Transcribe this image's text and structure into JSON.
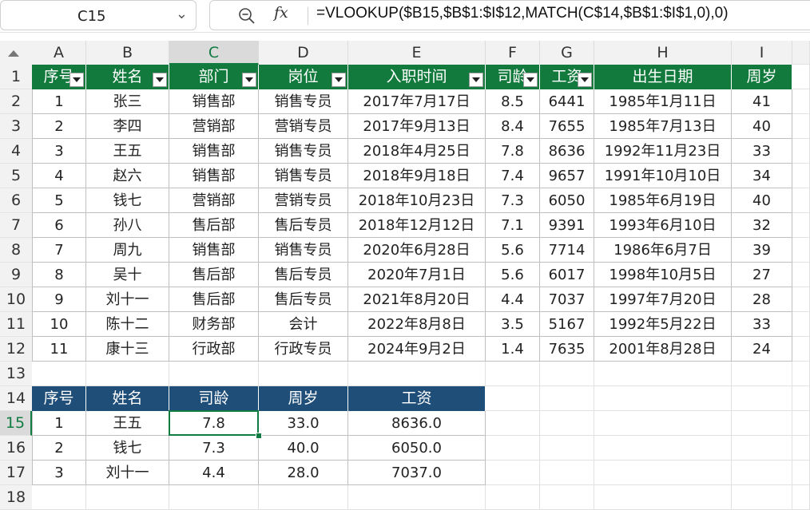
{
  "name_box": {
    "value": "C15"
  },
  "formula_bar": {
    "formula": "=VLOOKUP($B15,$B$1:$I$12,MATCH(C$14,$B$1:$I$1,0),0)"
  },
  "column_headers": [
    "A",
    "B",
    "C",
    "D",
    "E",
    "F",
    "G",
    "H",
    "I"
  ],
  "row_headers": [
    "1",
    "2",
    "3",
    "4",
    "5",
    "6",
    "7",
    "8",
    "9",
    "10",
    "11",
    "12",
    "13",
    "14",
    "15",
    "16",
    "17",
    "18"
  ],
  "selected_cell": "C15",
  "table1": {
    "headers": [
      "序号",
      "姓名",
      "部门",
      "岗位",
      "入职时间",
      "司龄",
      "工资",
      "出生日期",
      "周岁"
    ],
    "rows": [
      [
        "1",
        "张三",
        "销售部",
        "销售专员",
        "2017年7月17日",
        "8.5",
        "6441",
        "1985年1月11日",
        "41"
      ],
      [
        "2",
        "李四",
        "营销部",
        "营销专员",
        "2017年9月13日",
        "8.4",
        "7655",
        "1985年7月13日",
        "40"
      ],
      [
        "3",
        "王五",
        "销售部",
        "销售专员",
        "2018年4月25日",
        "7.8",
        "8636",
        "1992年11月23日",
        "33"
      ],
      [
        "4",
        "赵六",
        "销售部",
        "销售专员",
        "2018年9月18日",
        "7.4",
        "9657",
        "1991年10月10日",
        "34"
      ],
      [
        "5",
        "钱七",
        "营销部",
        "营销专员",
        "2018年10月23日",
        "7.3",
        "6050",
        "1985年6月19日",
        "40"
      ],
      [
        "6",
        "孙八",
        "售后部",
        "售后专员",
        "2018年12月12日",
        "7.1",
        "9391",
        "1993年6月10日",
        "32"
      ],
      [
        "7",
        "周九",
        "销售部",
        "销售专员",
        "2020年6月28日",
        "5.6",
        "7714",
        "1986年6月7日",
        "39"
      ],
      [
        "8",
        "吴十",
        "售后部",
        "售后专员",
        "2020年7月1日",
        "5.6",
        "6017",
        "1998年10月5日",
        "27"
      ],
      [
        "9",
        "刘十一",
        "售后部",
        "售后专员",
        "2021年8月20日",
        "4.4",
        "7037",
        "1997年7月20日",
        "28"
      ],
      [
        "10",
        "陈十二",
        "财务部",
        "会计",
        "2022年8月8日",
        "3.5",
        "5167",
        "1992年5月22日",
        "33"
      ],
      [
        "11",
        "康十三",
        "行政部",
        "行政专员",
        "2024年9月2日",
        "1.4",
        "7635",
        "2001年8月28日",
        "24"
      ]
    ]
  },
  "table2": {
    "headers": [
      "序号",
      "姓名",
      "司龄",
      "周岁",
      "工资"
    ],
    "rows": [
      [
        "1",
        "王五",
        "7.8",
        "33.0",
        "8636.0"
      ],
      [
        "2",
        "钱七",
        "7.3",
        "40.0",
        "6050.0"
      ],
      [
        "3",
        "刘十一",
        "4.4",
        "28.0",
        "7037.0"
      ]
    ]
  },
  "colors": {
    "table1_header": "#127a3c",
    "table2_header": "#1f4e79",
    "selection": "#107c41"
  }
}
